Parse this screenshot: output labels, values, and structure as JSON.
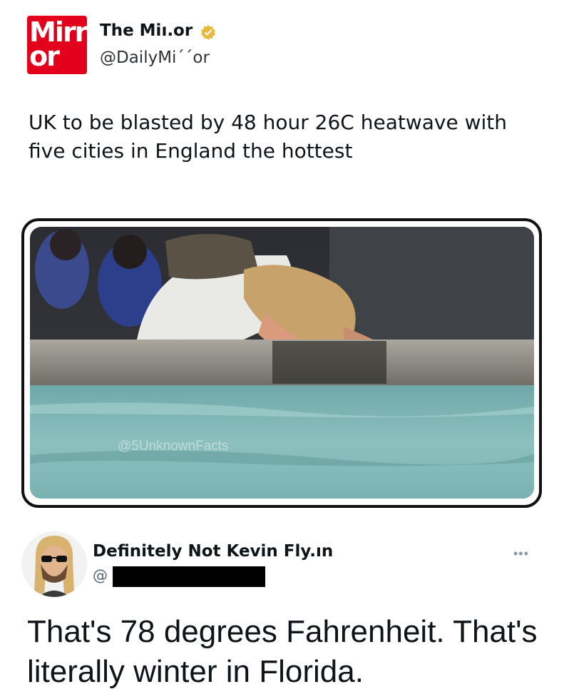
{
  "tweet": {
    "avatar_text_top": "Mirr",
    "avatar_text_bottom": "or",
    "author_name": "The Miı.or",
    "author_handle": "@DailyMi´´or",
    "body": "UK to be blasted by 48 hour 26C heatwave with five cities in England the hottest",
    "media_watermark": "@5UnknownFacts",
    "colors": {
      "brand": "#e2001a",
      "verified": "#e8b83a"
    }
  },
  "reply": {
    "author_name": "Definitely Not Kevin Fly.ın",
    "handle_prefix": "@",
    "more_icon": "•••",
    "body": "That's 78 degrees Fahrenheit. That's literally winter in Florida."
  }
}
